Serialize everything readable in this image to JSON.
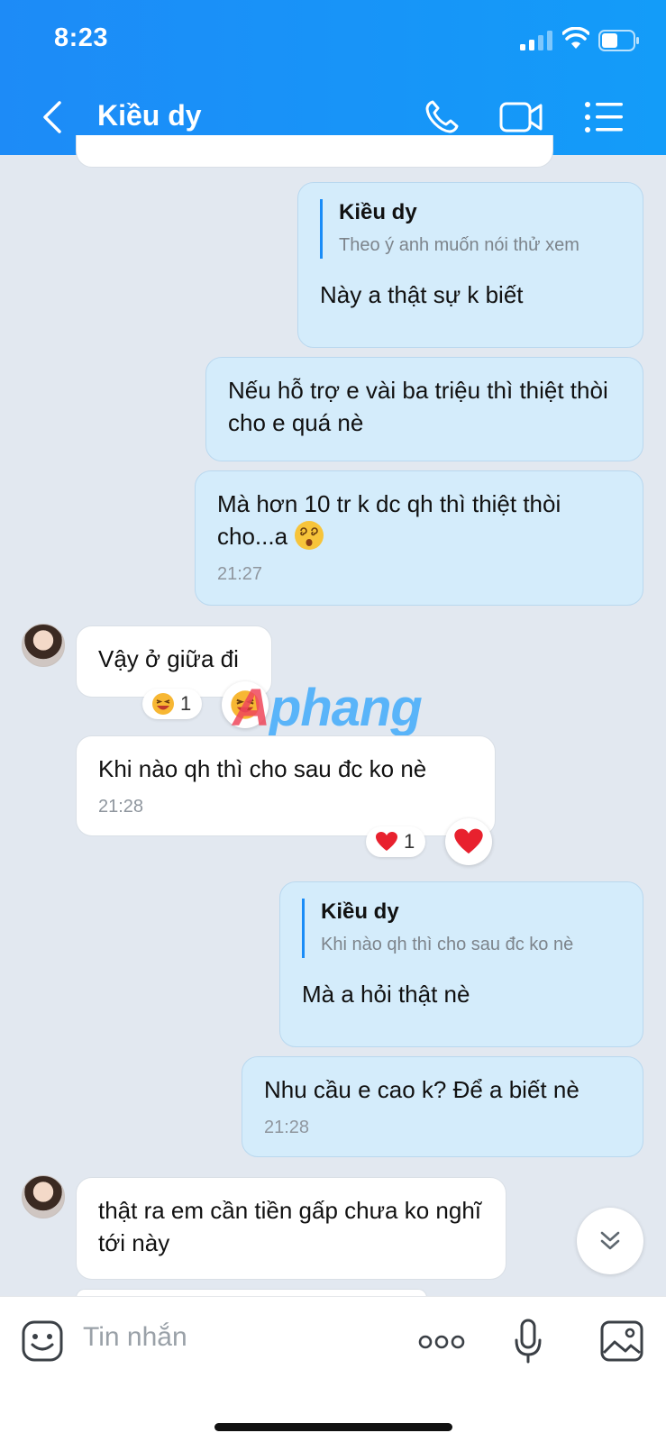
{
  "status_bar": {
    "time": "8:23"
  },
  "header": {
    "contact_name": "Kiều dy",
    "icons": [
      "back-icon",
      "phone-icon",
      "video-icon",
      "menu-list-icon"
    ]
  },
  "messages": [
    {
      "direction": "sent",
      "quote": {
        "name": "Kiều dy",
        "text": "Theo ý anh muốn nói thử xem"
      },
      "text": "Này a thật sự k biết"
    },
    {
      "direction": "sent",
      "text": "Nếu hỗ trợ e vài ba triệu thì thiệt thòi cho e quá nè"
    },
    {
      "direction": "sent",
      "text": "Mà hơn 10 tr k dc qh thì thiệt thòi cho...a",
      "emoji": "dizzy-face",
      "time": "21:27"
    },
    {
      "direction": "received",
      "text": "Vậy ở giữa đi",
      "reaction": {
        "emoji": "laughing-face",
        "count": "1"
      }
    },
    {
      "direction": "received",
      "text": "Khi nào qh thì cho sau đc ko nè",
      "time": "21:28",
      "reaction": {
        "emoji": "red-heart",
        "count": "1"
      }
    },
    {
      "direction": "sent",
      "quote": {
        "name": "Kiều dy",
        "text": "Khi nào qh thì cho sau đc ko nè"
      },
      "text": "Mà a hỏi thật nè"
    },
    {
      "direction": "sent",
      "text": "Nhu cầu e cao k? Để a biết nè",
      "time": "21:28"
    },
    {
      "direction": "received",
      "text": "thật ra em cần tiền gấp chưa ko nghĩ tới này"
    }
  ],
  "watermark": {
    "prefix": "A",
    "rest": "phang"
  },
  "composer": {
    "placeholder": "Tin nhắn"
  },
  "colors": {
    "header_blue": "#1d8bf7",
    "sent_bubble": "#d4ecfb",
    "received_bubble": "#ffffff",
    "background": "#e2e8f0"
  }
}
